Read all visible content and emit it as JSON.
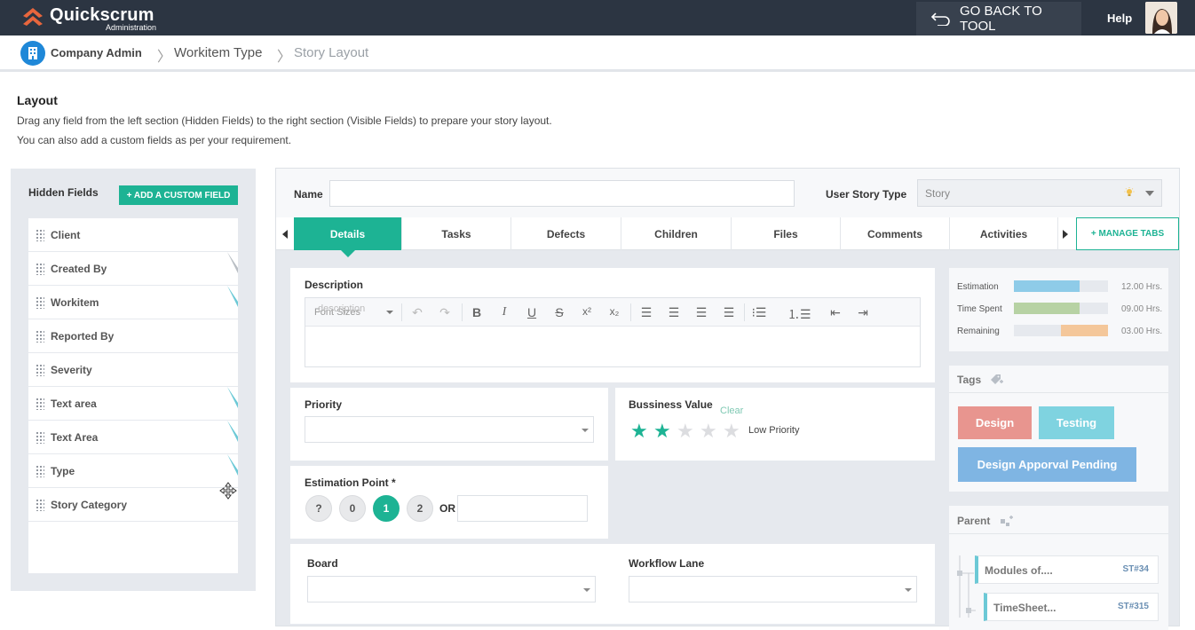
{
  "header": {
    "brand": "Quickscrum",
    "brand_sub": "Administration",
    "go_back": "GO BACK TO TOOL",
    "help": "Help"
  },
  "breadcrumb": {
    "items": [
      "Company Admin",
      "Workitem Type",
      "Story Layout"
    ]
  },
  "intro": {
    "title": "Layout",
    "line1": "Drag any field from the left section (Hidden Fields) to the right section (Visible Fields) to prepare your story layout.",
    "line2": "You can also add a custom fields as per your requirement."
  },
  "hidden_fields": {
    "title": "Hidden Fields",
    "add_button": "+ ADD A CUSTOM FIELD",
    "items": [
      {
        "label": "Client"
      },
      {
        "label": "Created By"
      },
      {
        "label": "Workitem"
      },
      {
        "label": "Reported By"
      },
      {
        "label": "Severity"
      },
      {
        "label": "Text area"
      },
      {
        "label": "Text Area"
      },
      {
        "label": "Type"
      },
      {
        "label": "Story Category"
      }
    ]
  },
  "editor": {
    "name_label": "Name",
    "user_story_type_label": "User Story Type",
    "user_story_type_value": "Story",
    "tabs": [
      "Details",
      "Tasks",
      "Defects",
      "Children",
      "Files",
      "Comments",
      "Activities"
    ],
    "active_tab": "Details",
    "manage_tabs": "+ MANAGE TABS",
    "description_label": "Description",
    "rte_font": "Font Sizes",
    "rte_font_overlay": "description",
    "priority_label": "Priority",
    "business_value_label": "Bussiness Value",
    "clear_label": "Clear",
    "business_value_stars": 2,
    "business_value_max": 5,
    "business_value_text": "Low Priority",
    "estimation_label": "Estimation Point *",
    "estimation_points": [
      "?",
      "0",
      "1",
      "2"
    ],
    "estimation_selected": "1",
    "or_label": "OR",
    "board_label": "Board",
    "workflow_label": "Workflow Lane"
  },
  "time": [
    {
      "label": "Estimation",
      "value": "12.00 Hrs.",
      "fraction_start": 0.0,
      "fraction_end": 0.7,
      "color": "#8ecbe8"
    },
    {
      "label": "Time Spent",
      "value": "09.00 Hrs.",
      "fraction_start": 0.0,
      "fraction_end": 0.7,
      "color": "#b7d2a4"
    },
    {
      "label": "Remaining",
      "value": "03.00 Hrs.",
      "fraction_start": 0.5,
      "fraction_end": 1.0,
      "color": "#f4c79a"
    }
  ],
  "tags": {
    "title": "Tags",
    "items": [
      {
        "label": "Design",
        "color": "#e8958f"
      },
      {
        "label": "Testing",
        "color": "#7fd3e0"
      },
      {
        "label": "Design Apporval Pending",
        "color": "#7fb5e3"
      }
    ]
  },
  "parent": {
    "title": "Parent",
    "items": [
      {
        "name": "Modules of....",
        "id": "ST#34"
      },
      {
        "name": "TimeSheet...",
        "id": "ST#315"
      }
    ]
  },
  "colors": {
    "topbar": "#2c3542",
    "accent": "#1db394",
    "breadcrumb_icon": "#1f88d8"
  }
}
